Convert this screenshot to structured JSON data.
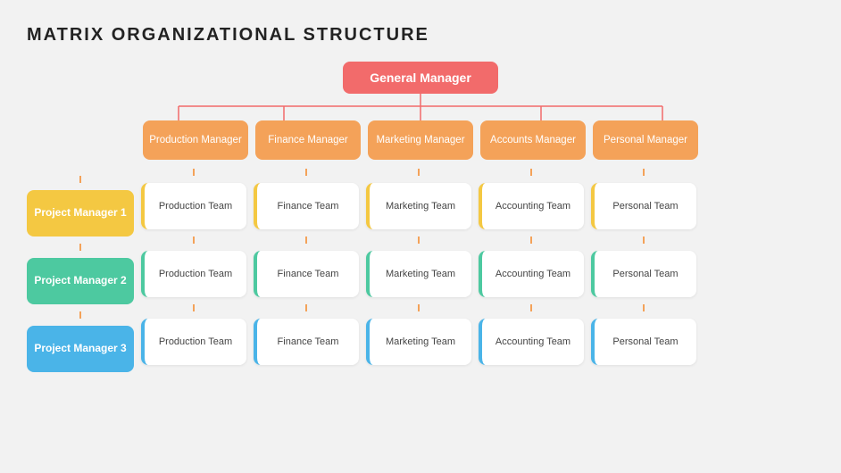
{
  "title": "MATRIX ORGANIZATIONAL STRUCTURE",
  "gm": {
    "label": "General Manager",
    "color": "#f26b6b"
  },
  "managers": [
    {
      "label": "Production Manager",
      "color": "#f4a259"
    },
    {
      "label": "Finance Manager",
      "color": "#f4a259"
    },
    {
      "label": "Marketing Manager",
      "color": "#f4a259"
    },
    {
      "label": "Accounts Manager",
      "color": "#f4a259"
    },
    {
      "label": "Personal Manager",
      "color": "#f4a259"
    }
  ],
  "projects": [
    {
      "label": "Project Manager 1",
      "class": "pm1",
      "accent": "yellow"
    },
    {
      "label": "Project Manager 2",
      "class": "pm2",
      "accent": "green"
    },
    {
      "label": "Project Manager 3",
      "class": "pm3",
      "accent": "blue"
    }
  ],
  "teams": [
    [
      "Production Team",
      "Finance Team",
      "Marketing Team",
      "Accounting Team",
      "Personal Team"
    ],
    [
      "Production Team",
      "Finance Team",
      "Marketing Team",
      "Accounting Team",
      "Personal Team"
    ],
    [
      "Production Team",
      "Finance Team",
      "Marketing Team",
      "Accounting Team",
      "Personal Team"
    ]
  ],
  "row_accents": [
    "yellow",
    "green",
    "blue"
  ],
  "col_accents": [
    "orange",
    "orange",
    "orange",
    "orange",
    "orange"
  ]
}
